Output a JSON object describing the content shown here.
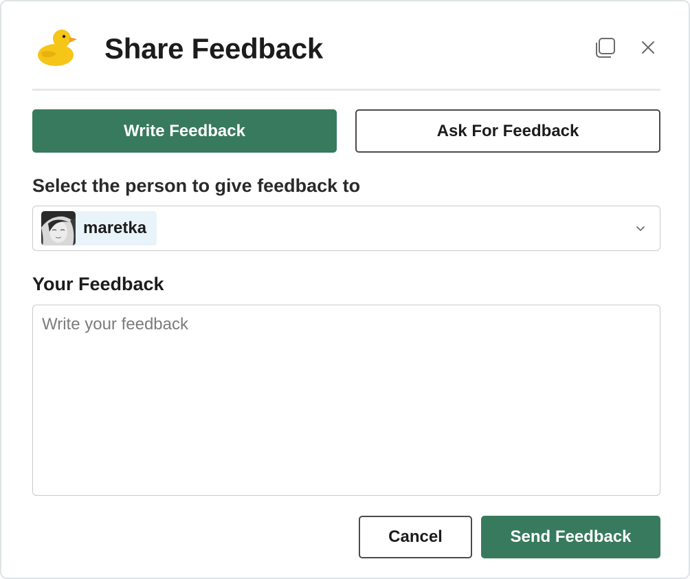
{
  "dialog": {
    "title": "Share Feedback",
    "logo_icon": "duck-icon",
    "copy_icon": "copy-icon",
    "close_icon": "close-icon"
  },
  "tabs": [
    {
      "label": "Write Feedback",
      "selected": true
    },
    {
      "label": "Ask For Feedback",
      "selected": false
    }
  ],
  "person_select": {
    "label": "Select the person to give feedback to",
    "selected_user": "maretka",
    "avatar_icon": "user-avatar",
    "chevron_icon": "chevron-down-icon"
  },
  "feedback": {
    "label": "Your Feedback",
    "placeholder": "Write your feedback",
    "value": ""
  },
  "actions": {
    "cancel_label": "Cancel",
    "send_label": "Send Feedback"
  },
  "colors": {
    "primary": "#387a5e",
    "duck_yellow": "#f5c518",
    "duck_beak": "#f39c1e"
  }
}
